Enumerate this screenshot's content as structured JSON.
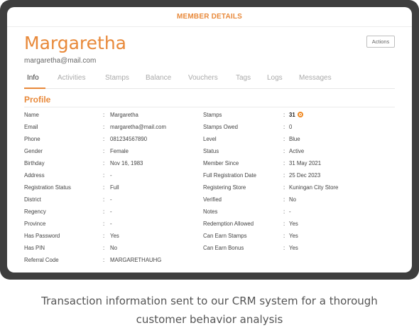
{
  "header": {
    "title": "MEMBER DETAILS"
  },
  "member": {
    "name": "Margaretha",
    "email": "margaretha@mail.com"
  },
  "actions_label": "Actions",
  "tabs": [
    "Info",
    "Activities",
    "Stamps",
    "Balance",
    "Vouchers",
    "Tags",
    "Logs",
    "Messages"
  ],
  "section_title": "Profile",
  "left_fields": [
    {
      "label": "Name",
      "value": "Margaretha"
    },
    {
      "label": "Email",
      "value": "margaretha@mail.com"
    },
    {
      "label": "Phone",
      "value": "081234567890"
    },
    {
      "label": "Gender",
      "value": "Female"
    },
    {
      "label": "Birthday",
      "value": "Nov 16, 1983"
    },
    {
      "label": "Address",
      "value": "-"
    },
    {
      "label": "Registration Status",
      "value": "Full"
    },
    {
      "label": "District",
      "value": "-"
    },
    {
      "label": "Regency",
      "value": "-"
    },
    {
      "label": "Province",
      "value": "-"
    },
    {
      "label": "Has Password",
      "value": "Yes"
    },
    {
      "label": "Has PIN",
      "value": "No"
    },
    {
      "label": "Referral Code",
      "value": "MARGARETHAUHG"
    }
  ],
  "right_fields": [
    {
      "label": "Stamps",
      "value": "31"
    },
    {
      "label": "Stamps Owed",
      "value": "0"
    },
    {
      "label": "Level",
      "value": "Blue"
    },
    {
      "label": "Status",
      "value": "Active"
    },
    {
      "label": "Member Since",
      "value": "31 May 2021"
    },
    {
      "label": "Full Registration Date",
      "value": "25 Dec 2023"
    },
    {
      "label": "Registering Store",
      "value": "Kuningan City Store"
    },
    {
      "label": "Verified",
      "value": "No"
    },
    {
      "label": "Notes",
      "value": "-"
    },
    {
      "label": "Redemption Allowed",
      "value": "Yes"
    },
    {
      "label": "Can Earn Stamps",
      "value": "Yes"
    },
    {
      "label": "Can Earn Bonus",
      "value": "Yes"
    }
  ],
  "separator": ":",
  "caption": "Transaction information sent to our CRM system for a thorough customer behavior analysis",
  "colors": {
    "accent": "#e8893a",
    "frame": "#3e3e3e"
  },
  "icons": {
    "stamps": "coin-icon"
  }
}
